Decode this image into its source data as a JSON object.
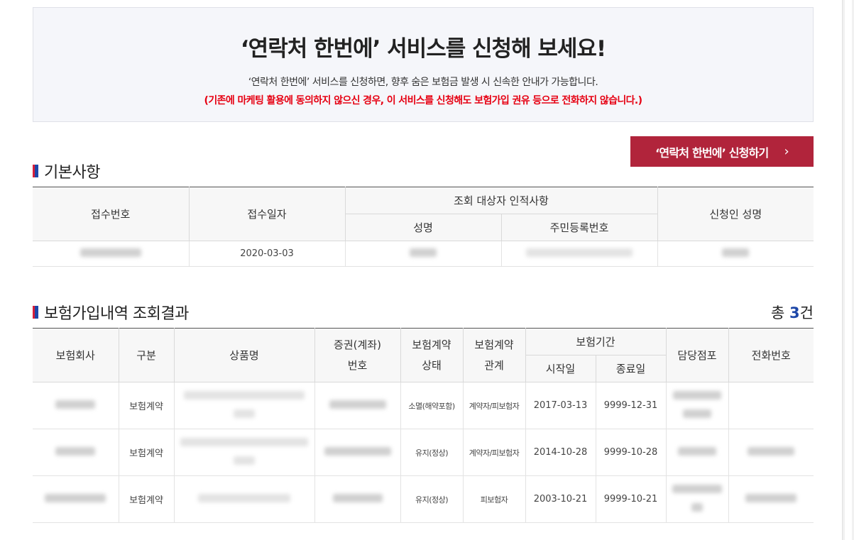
{
  "banner": {
    "title": "‘연락처 한번에’ 서비스를 신청해 보세요!",
    "description": "‘연락처 한번에’ 서비스를 신청하면, 향후 숨은 보험금 발생 시 신속한 안내가 가능합니다.",
    "notice": "(기존에 마케팅 활용에 동의하지 않으신 경우, 이 서비스를 신청해도 보험가입 권유 등으로 전화하지 않습니다.)"
  },
  "apply_button": {
    "label": "‘연락처 한번에’ 신청하기",
    "chevron": "›"
  },
  "basic": {
    "title": "기본사항",
    "headers": {
      "receipt_no": "접수번호",
      "receipt_date": "접수일자",
      "subject_group": "조회 대상자 인적사항",
      "name": "성명",
      "rrn": "주민등록번호",
      "applicant": "신청인 성명"
    },
    "row": {
      "receipt_date": "2020-03-03"
    }
  },
  "results": {
    "title": "보험가입내역 조회결과",
    "total_prefix": "총 ",
    "total_count": "3",
    "total_suffix": "건",
    "headers": {
      "company": "보험회사",
      "category": "구분",
      "product": "상품명",
      "policy_line1": "증권(계좌)",
      "policy_line2": "번호",
      "status_line1": "보험계약",
      "status_line2": "상태",
      "relation_line1": "보험계약",
      "relation_line2": "관계",
      "period": "보험기간",
      "start": "시작일",
      "end": "종료일",
      "branch": "담당점포",
      "phone": "전화번호"
    },
    "rows": [
      {
        "category": "보험계약",
        "status": "소멸(해약포함)",
        "relation": "계약자/피보험자",
        "start": "2017-03-13",
        "end": "9999-12-31"
      },
      {
        "category": "보험계약",
        "status": "유지(정상)",
        "relation": "계약자/피보험자",
        "start": "2014-10-28",
        "end": "9999-10-28"
      },
      {
        "category": "보험계약",
        "status": "유지(정상)",
        "relation": "피보험자",
        "start": "2003-10-21",
        "end": "9999-10-21"
      }
    ]
  }
}
